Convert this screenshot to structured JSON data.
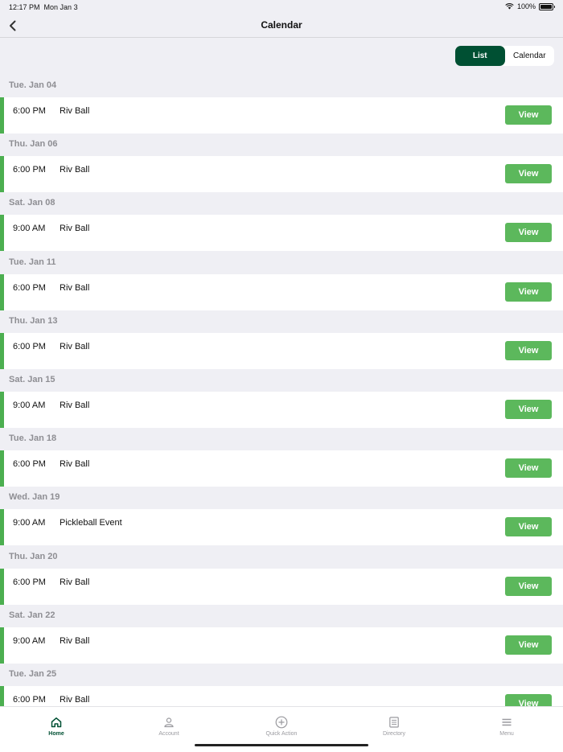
{
  "status_bar": {
    "time": "12:17 PM",
    "date": "Mon Jan 3",
    "battery": "100%"
  },
  "nav": {
    "title": "Calendar",
    "back_icon": "chevron-left-icon"
  },
  "view_toggle": {
    "list_label": "List",
    "calendar_label": "Calendar",
    "selected": "List",
    "active_color": "#005033"
  },
  "events": [
    {
      "date": "Tue. Jan 04",
      "time": "6:00 PM",
      "name": "Riv Ball",
      "action": "View"
    },
    {
      "date": "Thu. Jan 06",
      "time": "6:00 PM",
      "name": "Riv Ball",
      "action": "View"
    },
    {
      "date": "Sat. Jan 08",
      "time": "9:00 AM",
      "name": "Riv Ball",
      "action": "View"
    },
    {
      "date": "Tue. Jan 11",
      "time": "6:00 PM",
      "name": "Riv Ball",
      "action": "View"
    },
    {
      "date": "Thu. Jan 13",
      "time": "6:00 PM",
      "name": "Riv Ball",
      "action": "View"
    },
    {
      "date": "Sat. Jan 15",
      "time": "9:00 AM",
      "name": "Riv Ball",
      "action": "View"
    },
    {
      "date": "Tue. Jan 18",
      "time": "6:00 PM",
      "name": "Riv Ball",
      "action": "View"
    },
    {
      "date": "Wed. Jan 19",
      "time": "9:00 AM",
      "name": "Pickleball Event",
      "action": "View"
    },
    {
      "date": "Thu. Jan 20",
      "time": "6:00 PM",
      "name": "Riv Ball",
      "action": "View"
    },
    {
      "date": "Sat. Jan 22",
      "time": "9:00 AM",
      "name": "Riv Ball",
      "action": "View"
    },
    {
      "date": "Tue. Jan 25",
      "time": "6:00 PM",
      "name": "Riv Ball",
      "action": "View"
    }
  ],
  "accent_color": "#4caf50",
  "tab_bar": {
    "tabs": [
      {
        "label": "Home",
        "icon": "home-icon",
        "active": true
      },
      {
        "label": "Account",
        "icon": "person-icon",
        "active": false
      },
      {
        "label": "Quick Action",
        "icon": "plus-circle-icon",
        "active": false
      },
      {
        "label": "Directory",
        "icon": "list-icon",
        "active": false
      },
      {
        "label": "Menu",
        "icon": "menu-icon",
        "active": false
      }
    ]
  }
}
